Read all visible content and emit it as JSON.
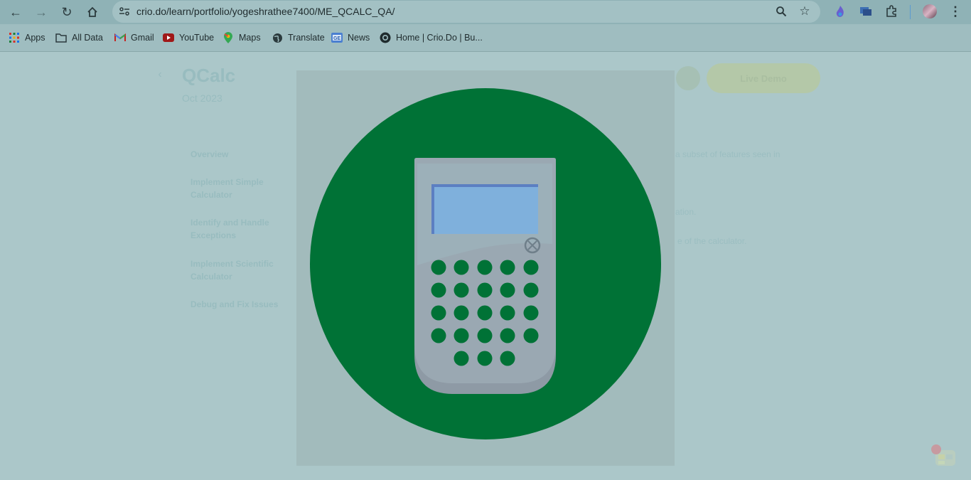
{
  "browser": {
    "url": "crio.do/learn/portfolio/yogeshrathee7400/ME_QCALC_QA/",
    "bookmarks": [
      "Apps",
      "All Data",
      "Gmail",
      "YouTube",
      "Maps",
      "Translate",
      "News",
      "Home | Crio.Do | Bu..."
    ]
  },
  "page": {
    "title": "QCalc",
    "date": "Oct 2023",
    "live_demo": "Live Demo",
    "sidebar": [
      "Overview",
      "Implement Simple Calculator",
      "Identify and Handle Exceptions",
      "Implement Scientific Calculator",
      "Debug and Fix Issues"
    ],
    "content_snippets": [
      "a subset of features seen in",
      "ation.",
      "e of the calculator."
    ]
  },
  "modal": {
    "image_icon": "calculator-icon"
  },
  "colors": {
    "circle": "#007236",
    "modal_bg": "#a2bbbc",
    "page_overlay": "#abc7c9"
  }
}
